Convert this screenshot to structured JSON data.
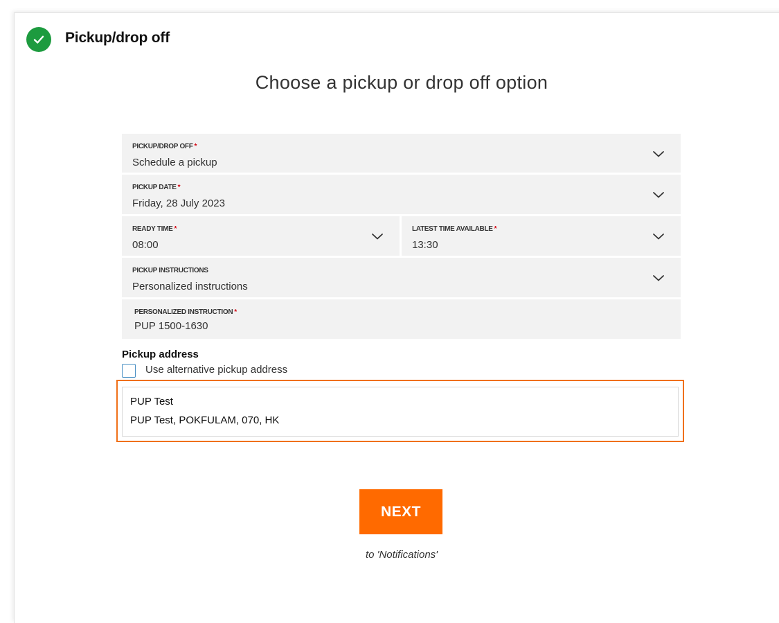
{
  "step": {
    "title": "Pickup/drop off",
    "status_icon": "check-icon",
    "status_color": "#1d9b3f"
  },
  "heading": "Choose a pickup or drop off option",
  "fields": {
    "pickup_drop_off": {
      "label": "PICKUP/DROP OFF",
      "required": "*",
      "value": "Schedule a pickup",
      "icon": "chevron-down-icon"
    },
    "pickup_date": {
      "label": "PICKUP DATE",
      "required": "*",
      "value": "Friday, 28 July 2023",
      "icon": "chevron-down-icon"
    },
    "ready_time": {
      "label": "READY TIME",
      "required": "*",
      "value": "08:00",
      "icon": "chevron-down-icon"
    },
    "latest_time": {
      "label": "LATEST TIME AVAILABLE",
      "required": "*",
      "value": "13:30",
      "icon": "chevron-down-icon"
    },
    "pickup_instructions": {
      "label": "PICKUP INSTRUCTIONS",
      "value": "Personalized instructions",
      "icon": "chevron-down-icon"
    },
    "personalized_instruction": {
      "label": "PERSONALIZED INSTRUCTION",
      "required": "*",
      "value": "PUP 1500-1630"
    }
  },
  "pickup_address": {
    "label": "Pickup address",
    "alt_checkbox_label": "Use alternative pickup address",
    "alt_checked": false,
    "line1": "PUP Test",
    "line2": "PUP Test, POKFULAM, 070, HK",
    "highlight_color": "#f07018"
  },
  "actions": {
    "next_label": "NEXT",
    "next_subtitle": "to 'Notifications'",
    "next_color": "#ff6a00"
  }
}
